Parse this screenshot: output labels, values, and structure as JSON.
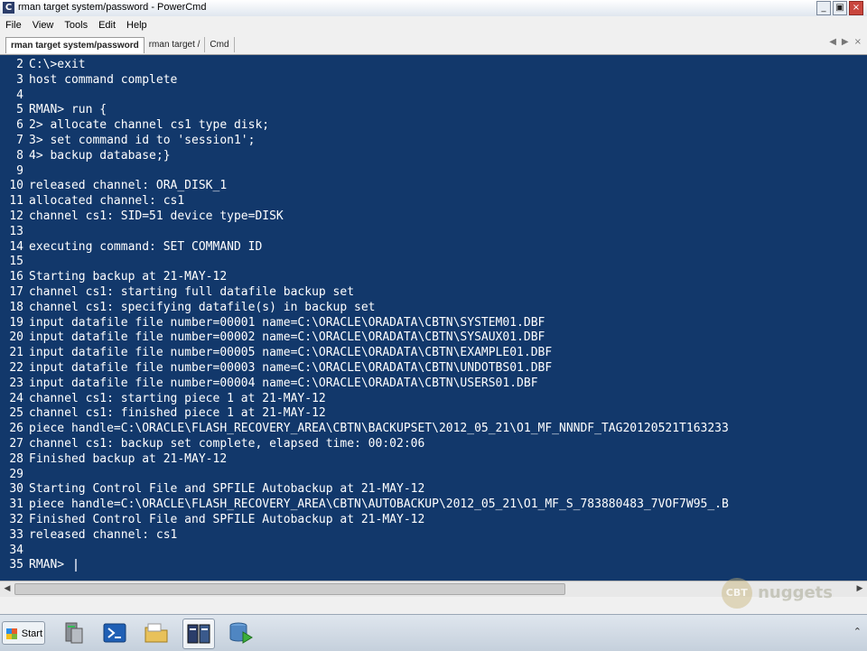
{
  "window": {
    "title": "rman target system/password - PowerCmd",
    "app_icon": "C",
    "buttons": {
      "minimize": "_",
      "restore": "▣",
      "close": "×"
    }
  },
  "menu": {
    "items": [
      "File",
      "View",
      "Tools",
      "Edit",
      "Help"
    ]
  },
  "tabs": {
    "items": [
      "rman target system/password",
      "rman target /",
      "Cmd"
    ],
    "active_index": 0,
    "nav": [
      "◀",
      "▶",
      "×"
    ]
  },
  "console": {
    "lines": [
      {
        "n": "2",
        "text": "C:\\>exit"
      },
      {
        "n": "3",
        "text": "host command complete"
      },
      {
        "n": "4",
        "text": ""
      },
      {
        "n": "5",
        "text": "RMAN> run {"
      },
      {
        "n": "6",
        "text": "2> allocate channel cs1 type disk;"
      },
      {
        "n": "7",
        "text": "3> set command id to 'session1';"
      },
      {
        "n": "8",
        "text": "4> backup database;}"
      },
      {
        "n": "9",
        "text": ""
      },
      {
        "n": "10",
        "text": "released channel: ORA_DISK_1"
      },
      {
        "n": "11",
        "text": "allocated channel: cs1"
      },
      {
        "n": "12",
        "text": "channel cs1: SID=51 device type=DISK"
      },
      {
        "n": "13",
        "text": ""
      },
      {
        "n": "14",
        "text": "executing command: SET COMMAND ID"
      },
      {
        "n": "15",
        "text": ""
      },
      {
        "n": "16",
        "text": "Starting backup at 21-MAY-12"
      },
      {
        "n": "17",
        "text": "channel cs1: starting full datafile backup set"
      },
      {
        "n": "18",
        "text": "channel cs1: specifying datafile(s) in backup set"
      },
      {
        "n": "19",
        "text": "input datafile file number=00001 name=C:\\ORACLE\\ORADATA\\CBTN\\SYSTEM01.DBF"
      },
      {
        "n": "20",
        "text": "input datafile file number=00002 name=C:\\ORACLE\\ORADATA\\CBTN\\SYSAUX01.DBF"
      },
      {
        "n": "21",
        "text": "input datafile file number=00005 name=C:\\ORACLE\\ORADATA\\CBTN\\EXAMPLE01.DBF"
      },
      {
        "n": "22",
        "text": "input datafile file number=00003 name=C:\\ORACLE\\ORADATA\\CBTN\\UNDOTBS01.DBF"
      },
      {
        "n": "23",
        "text": "input datafile file number=00004 name=C:\\ORACLE\\ORADATA\\CBTN\\USERS01.DBF"
      },
      {
        "n": "24",
        "text": "channel cs1: starting piece 1 at 21-MAY-12"
      },
      {
        "n": "25",
        "text": "channel cs1: finished piece 1 at 21-MAY-12"
      },
      {
        "n": "26",
        "text": "piece handle=C:\\ORACLE\\FLASH_RECOVERY_AREA\\CBTN\\BACKUPSET\\2012_05_21\\O1_MF_NNNDF_TAG20120521T163233"
      },
      {
        "n": "27",
        "text": "channel cs1: backup set complete, elapsed time: 00:02:06"
      },
      {
        "n": "28",
        "text": "Finished backup at 21-MAY-12"
      },
      {
        "n": "29",
        "text": ""
      },
      {
        "n": "30",
        "text": "Starting Control File and SPFILE Autobackup at 21-MAY-12"
      },
      {
        "n": "31",
        "text": "piece handle=C:\\ORACLE\\FLASH_RECOVERY_AREA\\CBTN\\AUTOBACKUP\\2012_05_21\\O1_MF_S_783880483_7VOF7W95_.B"
      },
      {
        "n": "32",
        "text": "Finished Control File and SPFILE Autobackup at 21-MAY-12"
      },
      {
        "n": "33",
        "text": "released channel: cs1"
      },
      {
        "n": "34",
        "text": ""
      },
      {
        "n": "35",
        "text": "RMAN> "
      }
    ],
    "background": "#12386b",
    "foreground": "#ffffff"
  },
  "scrollbar": {
    "left_arrow": "◀",
    "right_arrow": "▶"
  },
  "watermark": {
    "badge": "CBT",
    "text": "nuggets"
  },
  "taskbar": {
    "start_label": "Start",
    "icons": [
      "server-manager-icon",
      "powershell-icon",
      "explorer-folder-icon",
      "powercmd-icon",
      "database-icon"
    ],
    "active_icon_index": 3,
    "tray_text": "⌃"
  }
}
